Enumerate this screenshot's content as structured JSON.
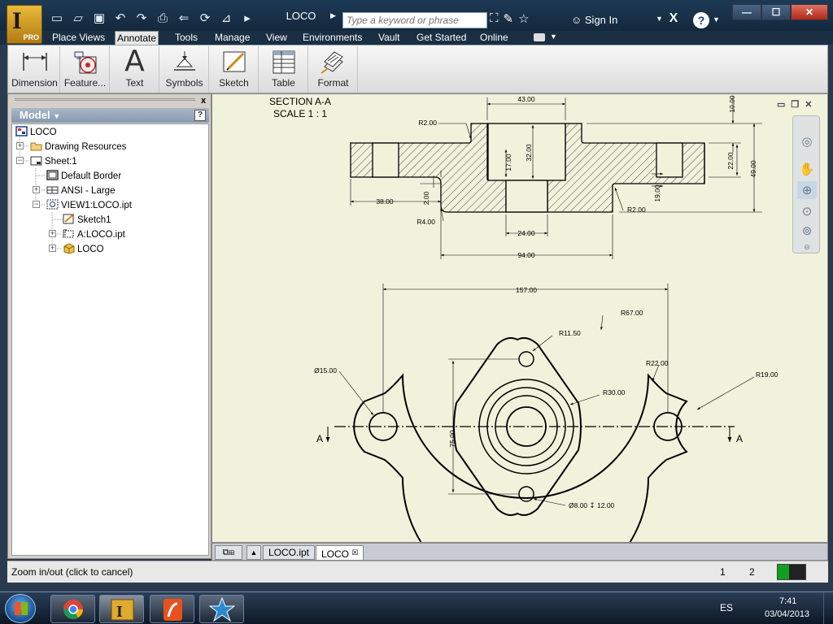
{
  "app": {
    "pro_badge": "PRO",
    "document_title": "LOCO"
  },
  "search": {
    "placeholder": "Type a keyword or phrase"
  },
  "signin": {
    "label": "Sign In"
  },
  "window_controls": {
    "minimize": "—",
    "maximize": "☐",
    "close": "✕"
  },
  "ribbon_tabs": [
    "Place Views",
    "Annotate",
    "Tools",
    "Manage",
    "View",
    "Environments",
    "Vault",
    "Get Started",
    "Online"
  ],
  "active_tab": "Annotate",
  "ribbon_buttons": [
    {
      "label": "Dimension",
      "icon": "dimension-icon"
    },
    {
      "label": "Feature...",
      "icon": "feature-control-icon"
    },
    {
      "label": "Text",
      "icon": "text-icon"
    },
    {
      "label": "Symbols",
      "icon": "symbols-icon"
    },
    {
      "label": "Sketch",
      "icon": "sketch-icon"
    },
    {
      "label": "Table",
      "icon": "table-icon"
    },
    {
      "label": "Format",
      "icon": "format-icon"
    }
  ],
  "browser": {
    "title": "Model",
    "help": "?",
    "close": "x",
    "tree": [
      {
        "label": "LOCO",
        "icon": "drawing-icon"
      },
      {
        "label": "Drawing Resources",
        "icon": "folder-icon"
      },
      {
        "label": "Sheet:1",
        "icon": "sheet-icon"
      },
      {
        "label": "Default Border",
        "icon": "border-icon"
      },
      {
        "label": "ANSI - Large",
        "icon": "title-block-icon"
      },
      {
        "label": "VIEW1:LOCO.ipt",
        "icon": "view-icon"
      },
      {
        "label": "Sketch1",
        "icon": "sketch-icon"
      },
      {
        "label": "A:LOCO.ipt",
        "icon": "section-view-icon"
      },
      {
        "label": "LOCO",
        "icon": "part-icon"
      }
    ]
  },
  "drawing": {
    "section_title": "SECTION A-A",
    "scale": "SCALE 1 : 1",
    "section_marker": "A",
    "dims": {
      "d43": "43.00",
      "d10": "10.00",
      "r2a": "R2.00",
      "d17": "17.00",
      "d32": "32.00",
      "d22": "22.00",
      "d49": "49.00",
      "d38": "38.00",
      "d2": "2.00",
      "r4": "R4.00",
      "d19": "19.00",
      "r2b": "R2.00",
      "d24": "24.00",
      "d94": "94.00",
      "d157": "157.00",
      "r67": "R67.00",
      "r115": "R11.50",
      "dia15": "Ø15.00",
      "r22": "R22.00",
      "r19": "R19.00",
      "r30": "R30.00",
      "d75": "75.00",
      "dia8": "Ø8.00 ↧ 12.00"
    }
  },
  "doc_tabs": [
    "LOCO.ipt",
    "LOCO"
  ],
  "active_doc_tab": "LOCO",
  "status": {
    "message": "Zoom in/out (click to cancel)",
    "n1": "1",
    "n2": "2",
    "meter_fill": 0.4,
    "meter_color": "#10a020"
  },
  "taskbar": {
    "apps": [
      "chrome-icon",
      "inventor-icon",
      "pdf-reader-icon",
      "star-app-icon"
    ],
    "language": "ES",
    "time": "7:41",
    "date": "03/04/2013"
  },
  "colors": {
    "canvas_bg": "#f1f2dc",
    "titlebar": "#1d3a55",
    "logo": "#e0aa30"
  }
}
